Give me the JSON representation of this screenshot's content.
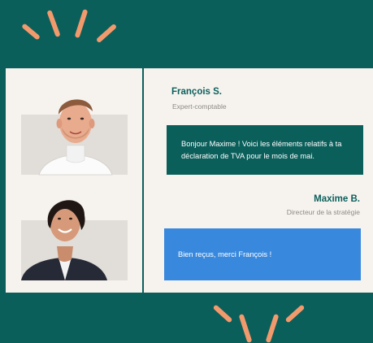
{
  "colors": {
    "background": "#0b5f5b",
    "card": "#f6f3ef",
    "accent_rays": "#f39a6d",
    "bubble_advisor": "#0b5f5b",
    "bubble_client": "#3889de",
    "name_text": "#0b5f5b",
    "role_text": "#8d8a86"
  },
  "conversation": {
    "advisor": {
      "name": "François S.",
      "role": "Expert-comptable",
      "message": "Bonjour Maxime ! Voici les éléments relatifs à ta déclaration de TVA pour le mois de mai."
    },
    "client": {
      "name": "Maxime B.",
      "role": "Directeur de la stratégie",
      "message": "Bien reçus, merci François !"
    }
  }
}
